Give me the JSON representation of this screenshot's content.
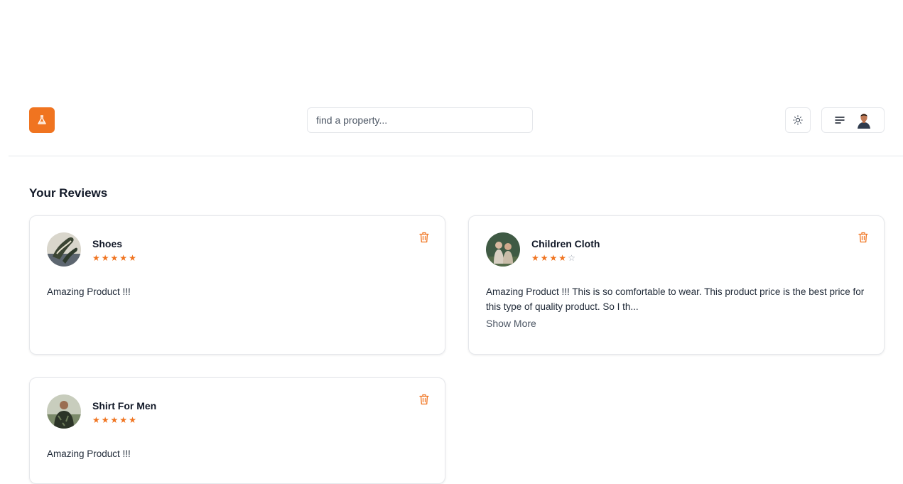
{
  "header": {
    "logo_icon": "flask-icon",
    "brand_color": "#f07420",
    "search": {
      "placeholder": "find a property...",
      "value": ""
    },
    "theme_toggle_icon": "sun-icon",
    "menu_icon": "menu-lines-icon",
    "user_avatar": "user-avatar"
  },
  "reviews_section": {
    "title": "Your Reviews",
    "reviews": [
      {
        "product_name": "Shoes",
        "rating": 5,
        "max_rating": 5,
        "text": "Amazing Product !!!",
        "show_more": ""
      },
      {
        "product_name": "Children Cloth",
        "rating": 4,
        "max_rating": 5,
        "text": "Amazing Product !!! This is so comfortable to wear. This product price is the best price for this type of quality product. So I th...",
        "show_more": "Show More"
      },
      {
        "product_name": "Shirt For Men",
        "rating": 5,
        "max_rating": 5,
        "text": "Amazing Product !!!",
        "show_more": ""
      }
    ]
  },
  "colors": {
    "accent": "#f07420",
    "star_filled": "#f07420",
    "star_empty": "#9ca3af",
    "border": "#e5e7eb"
  }
}
